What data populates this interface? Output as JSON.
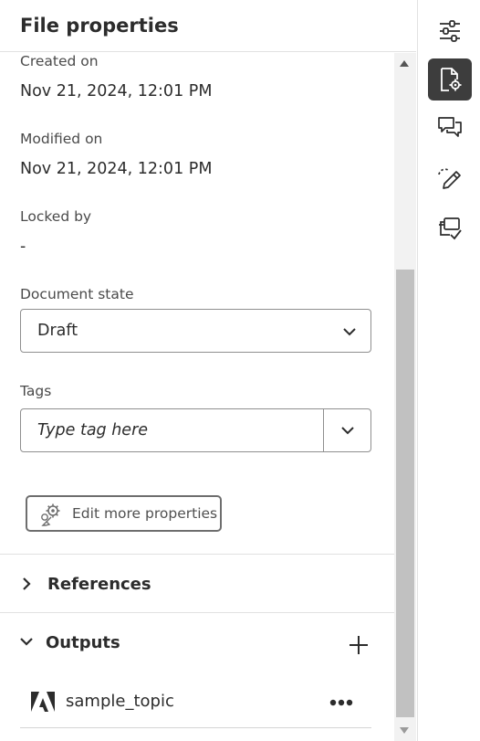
{
  "panel": {
    "title": "File properties",
    "created": {
      "label": "Created on",
      "value": "Nov 21, 2024, 12:01 PM"
    },
    "modified": {
      "label": "Modified on",
      "value": "Nov 21, 2024, 12:01 PM"
    },
    "locked": {
      "label": "Locked by",
      "value": "-"
    },
    "document_state": {
      "label": "Document state",
      "selected": "Draft"
    },
    "tags": {
      "label": "Tags",
      "placeholder": "Type tag here"
    },
    "edit_button_label": "Edit more properties",
    "references": {
      "title": "References",
      "expanded": false
    },
    "outputs": {
      "title": "Outputs",
      "expanded": true,
      "items": [
        {
          "name": "sample_topic"
        }
      ]
    }
  },
  "rail": {
    "items": [
      {
        "icon": "sliders-icon",
        "active": false
      },
      {
        "icon": "file-settings-icon",
        "active": true
      },
      {
        "icon": "comments-icon",
        "active": false
      },
      {
        "icon": "pencil-icon",
        "active": false
      },
      {
        "icon": "review-copies-icon",
        "active": false
      }
    ]
  },
  "colors": {
    "active_rail_bg": "#3d3d3d",
    "border": "#8f8f8f",
    "text": "#2c2c2c"
  }
}
